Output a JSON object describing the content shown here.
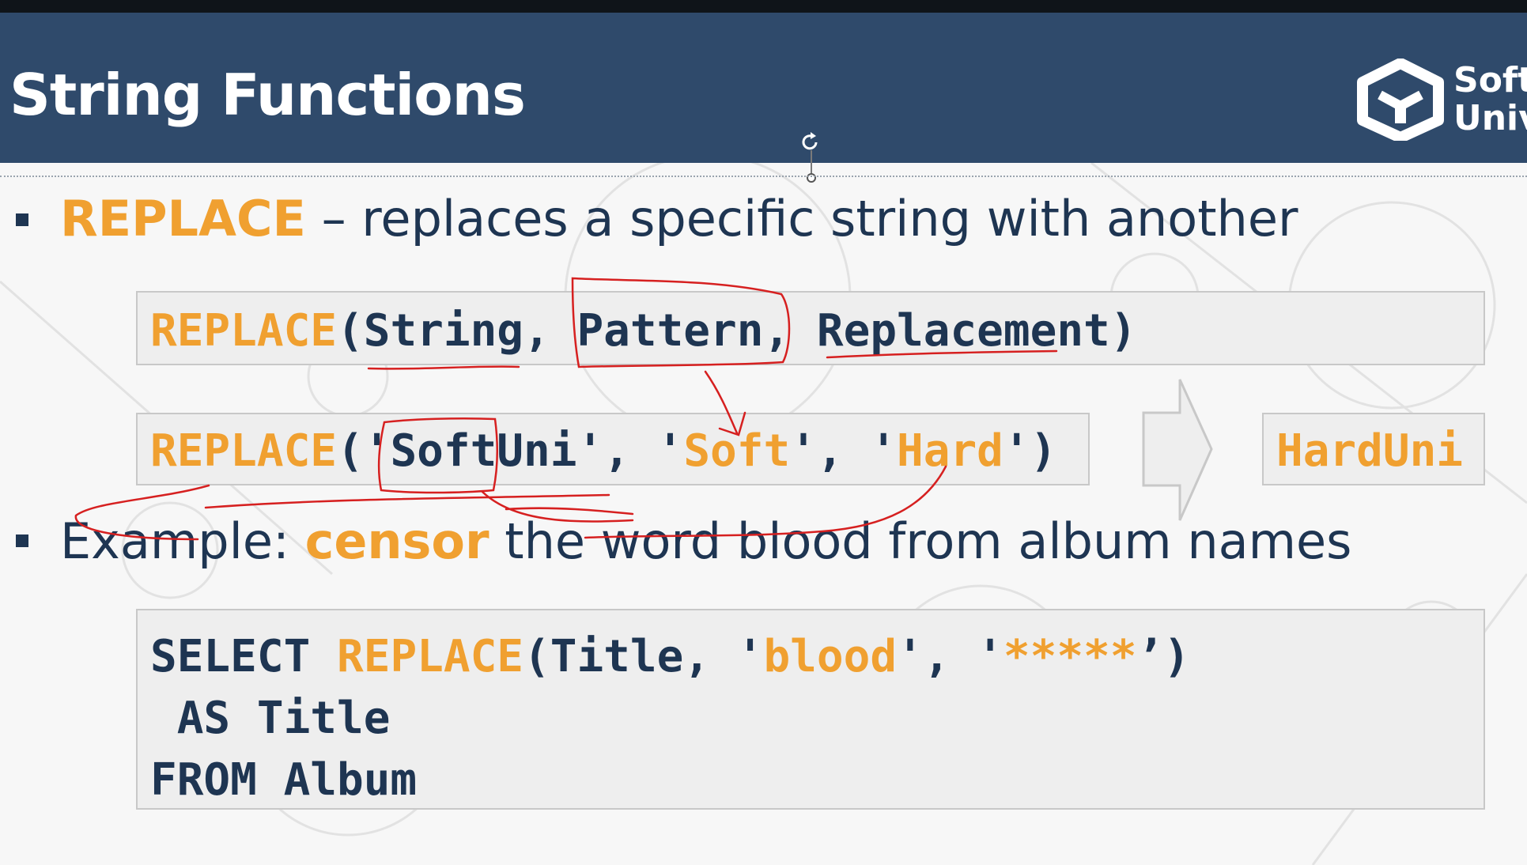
{
  "slide": {
    "title": "String Functions",
    "logo_line1": "Soft",
    "logo_line2": "Univ"
  },
  "bullet1": {
    "keyword": "REPLACE",
    "text": " – replaces a specific string with another"
  },
  "syntax": {
    "func": "REPLACE",
    "args": "(String, Pattern, Replacement)"
  },
  "example_call": {
    "func": "REPLACE",
    "open": "('SoftUni', '",
    "pattern": "Soft",
    "mid": "', '",
    "replacement": "Hard",
    "close": "')"
  },
  "result": "HardUni",
  "bullet2": {
    "prefix": "Example: ",
    "keyword": "censor",
    "text": " the word blood from album names"
  },
  "query": {
    "select": "SELECT ",
    "func": "REPLACE",
    "args_open": "(Title, '",
    "pattern": "blood",
    "args_mid": "', '",
    "replacement": "*****",
    "args_close": "’)",
    "line2": " AS Title",
    "line3": "FROM Album"
  },
  "colors": {
    "header_bg": "#2f4a6b",
    "keyword": "#f0a030",
    "text": "#1e3552",
    "annotation": "#d62020"
  },
  "icons": [
    "softuni-logo-icon",
    "rotate-handle-icon",
    "right-arrow-icon"
  ]
}
